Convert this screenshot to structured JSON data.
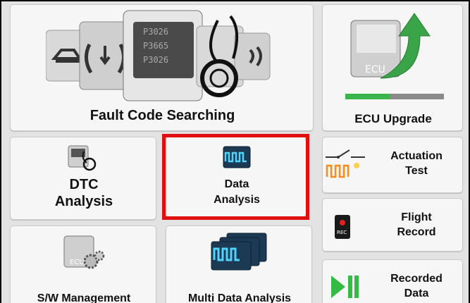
{
  "tiles": {
    "fault_code": {
      "label": "Fault Code Searching",
      "codes": [
        "P3026",
        "P3665",
        "P3026"
      ]
    },
    "ecu_upgrade": {
      "label": "ECU Upgrade",
      "ecu_text": "ECU",
      "progress": 0.45
    },
    "dtc_analysis": {
      "line1": "DTC",
      "line2": "Analysis"
    },
    "data_analysis": {
      "line1": "Data",
      "line2": "Analysis",
      "selected": true
    },
    "actuation_test": {
      "line1": "Actuation",
      "line2": "Test"
    },
    "flight_record": {
      "line1": "Flight",
      "line2": "Record",
      "rec_text": "REC"
    },
    "sw_management": {
      "label": "S/W Management",
      "ecu_text": "ECU"
    },
    "multi_data": {
      "label": "Multi Data Analysis"
    },
    "recorded_data": {
      "line1": "Recorded",
      "line2": "Data"
    }
  },
  "colors": {
    "highlight": "#e01010",
    "progress": "#39b54a",
    "play": "#33bb44"
  }
}
